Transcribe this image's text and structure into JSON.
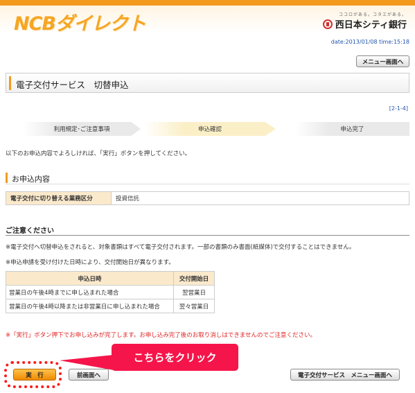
{
  "header": {
    "logo_text": "NCBダイレクト",
    "bank_tagline": "ココロがある。コタエがある。",
    "bank_name": "西日本シティ銀行",
    "datetime": "date:2013/01/08 time:15:18",
    "menu_button": "メニュー画面へ"
  },
  "page": {
    "title": "電子交付サービス　切替申込",
    "page_number": "[2-1-4]",
    "steps": [
      "利用規定･ご注意事項",
      "申込確認",
      "申込完了"
    ],
    "active_step": 1,
    "intro": "以下のお申込内容でよろしければ、「実行」ボタンを押してください。"
  },
  "application": {
    "heading": "お申込内容",
    "label": "電子交付に切り替える業務区分",
    "value": "投資信託"
  },
  "notice": {
    "heading": "ご注意ください",
    "note1": "※電子交付へ切替申込をされると、対象書類はすべて電子交付されます。一部の書類のみ書面(紙媒体)で交付することはできません。",
    "note2": "※申込申請を受け付けた日時により、交付開始日が異なります。",
    "table_headers": [
      "申込日時",
      "交付開始日"
    ],
    "rows": [
      [
        "営業日の午後4時までに申し込まれた場合",
        "翌営業日"
      ],
      [
        "営業日の午後4時以降または非営業日に申し込まれた場合",
        "翌々営業日"
      ]
    ],
    "warning": "※「実行」ボタン押下でお申し込みが完了します。お申し込み完了後のお取り消しはできませんのでご注意ください。"
  },
  "actions": {
    "execute": "実　行",
    "previous": "前画面へ",
    "service_menu": "電子交付サービス　メニュー画面へ",
    "callout": "こちらをクリック"
  },
  "colors": {
    "brand_orange": "#f39a1e",
    "callout_red": "#f5154a",
    "highlight_ring": "#ff1a1a",
    "link_blue": "#2255aa"
  }
}
